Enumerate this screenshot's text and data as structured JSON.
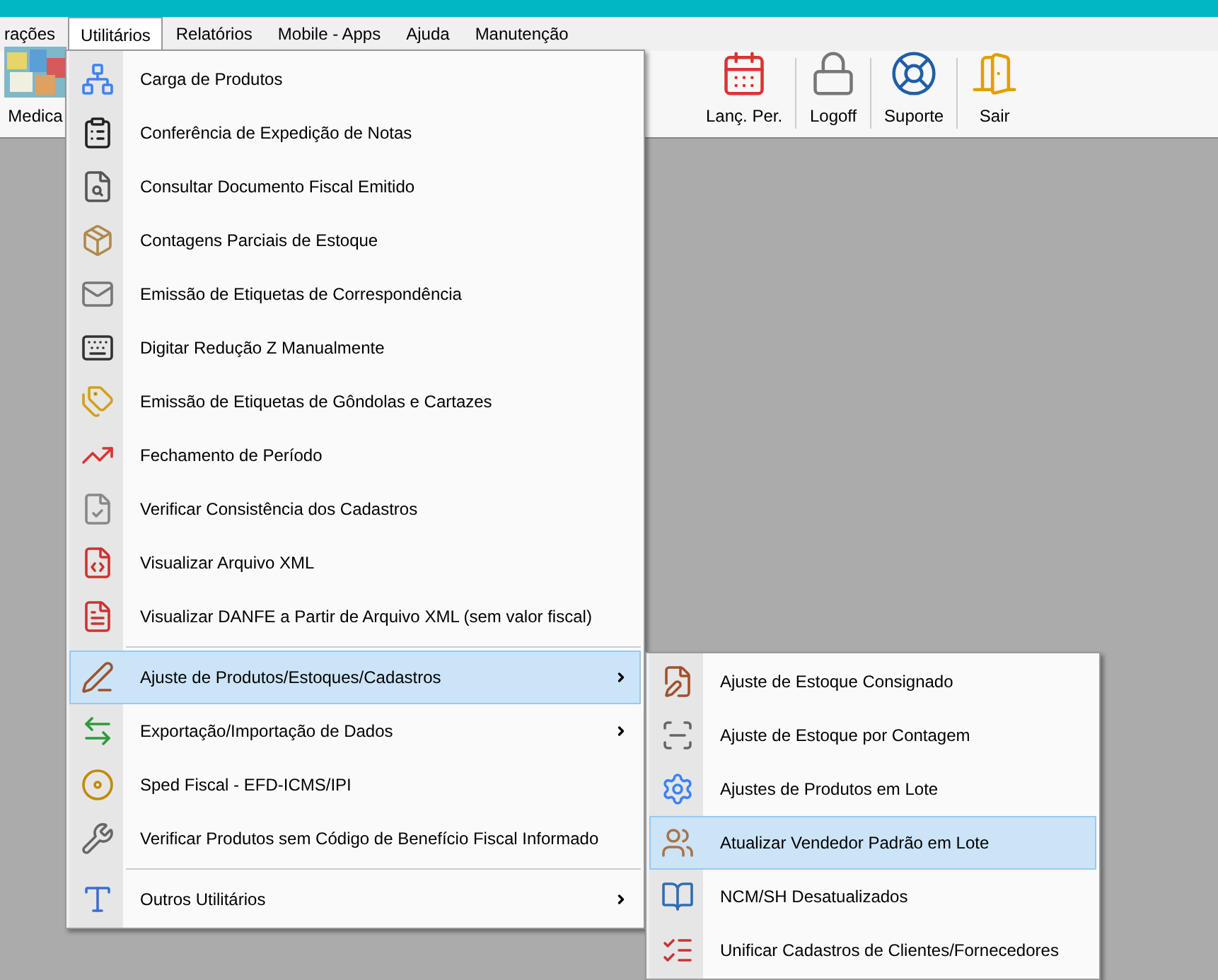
{
  "menubar": [
    {
      "label": "rações",
      "selected": false
    },
    {
      "label": "Utilitários",
      "selected": true
    },
    {
      "label": "Relatórios",
      "selected": false
    },
    {
      "label": "Mobile - Apps",
      "selected": false
    },
    {
      "label": "Ajuda",
      "selected": false
    },
    {
      "label": "Manutenção",
      "selected": false
    }
  ],
  "toolbar": [
    {
      "label": "Medica"
    },
    {
      "label": "Lanç. Per."
    },
    {
      "label": "Logoff"
    },
    {
      "label": "Suporte"
    },
    {
      "label": "Sair"
    }
  ],
  "menu": {
    "groups": [
      [
        {
          "label": "Carga de Produtos",
          "has_submenu": false,
          "selected": false
        },
        {
          "label": "Conferência de Expedição de Notas",
          "has_submenu": false,
          "selected": false
        },
        {
          "label": "Consultar Documento Fiscal Emitido",
          "has_submenu": false,
          "selected": false
        },
        {
          "label": "Contagens Parciais de Estoque",
          "has_submenu": false,
          "selected": false
        },
        {
          "label": "Emissão de Etiquetas de Correspondência",
          "has_submenu": false,
          "selected": false
        },
        {
          "label": "Digitar Redução Z Manualmente",
          "has_submenu": false,
          "selected": false
        },
        {
          "label": "Emissão de Etiquetas de Gôndolas e Cartazes",
          "has_submenu": false,
          "selected": false
        },
        {
          "label": "Fechamento de Período",
          "has_submenu": false,
          "selected": false
        },
        {
          "label": "Verificar Consistência dos Cadastros",
          "has_submenu": false,
          "selected": false
        },
        {
          "label": "Visualizar Arquivo XML",
          "has_submenu": false,
          "selected": false
        },
        {
          "label": "Visualizar DANFE a Partir de Arquivo XML (sem valor fiscal)",
          "has_submenu": false,
          "selected": false
        }
      ],
      [
        {
          "label": "Ajuste de Produtos/Estoques/Cadastros",
          "has_submenu": true,
          "selected": true
        },
        {
          "label": "Exportação/Importação de Dados",
          "has_submenu": true,
          "selected": false
        },
        {
          "label": "Sped Fiscal - EFD-ICMS/IPI",
          "has_submenu": false,
          "selected": false
        },
        {
          "label": "Verificar Produtos sem Código de Benefício Fiscal Informado",
          "has_submenu": false,
          "selected": false
        }
      ],
      [
        {
          "label": "Outros Utilitários",
          "has_submenu": true,
          "selected": false
        }
      ]
    ]
  },
  "submenu": {
    "items": [
      {
        "label": "Ajuste de Estoque Consignado",
        "selected": false
      },
      {
        "label": "Ajuste de Estoque por Contagem",
        "selected": false
      },
      {
        "label": "Ajustes de Produtos em Lote",
        "selected": false
      },
      {
        "label": "Atualizar Vendedor Padrão em Lote",
        "selected": true
      },
      {
        "label": "NCM/SH Desatualizados",
        "selected": false
      },
      {
        "label": "Unificar Cadastros de Clientes/Fornecedores",
        "selected": false
      }
    ]
  }
}
